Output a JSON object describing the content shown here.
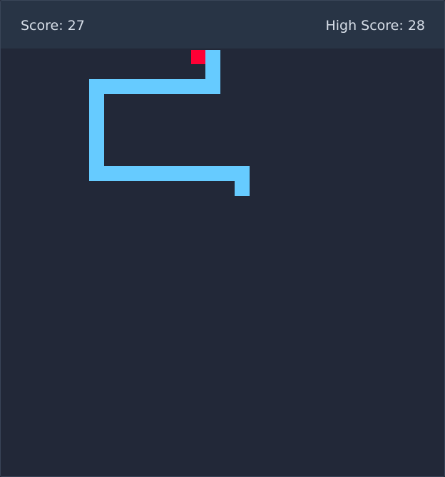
{
  "game": {
    "title": "",
    "score_label": "Score: 27",
    "high_score_label": "High Score: 28",
    "score": 27,
    "high_score": 28
  },
  "board": {
    "columns": 31,
    "rows": 30
  },
  "snake": {
    "color": "#66cbff",
    "segments": [
      {
        "col": 16,
        "row": 10
      },
      {
        "col": 16,
        "row": 9
      },
      {
        "col": 15,
        "row": 9
      },
      {
        "col": 14,
        "row": 9
      },
      {
        "col": 13,
        "row": 9
      },
      {
        "col": 12,
        "row": 9
      },
      {
        "col": 11,
        "row": 9
      },
      {
        "col": 10,
        "row": 9
      },
      {
        "col": 9,
        "row": 9
      },
      {
        "col": 8,
        "row": 9
      },
      {
        "col": 7,
        "row": 9
      },
      {
        "col": 6,
        "row": 9
      },
      {
        "col": 6,
        "row": 8
      },
      {
        "col": 6,
        "row": 7
      },
      {
        "col": 6,
        "row": 6
      },
      {
        "col": 6,
        "row": 5
      },
      {
        "col": 6,
        "row": 4
      },
      {
        "col": 6,
        "row": 3
      },
      {
        "col": 7,
        "row": 3
      },
      {
        "col": 8,
        "row": 3
      },
      {
        "col": 9,
        "row": 3
      },
      {
        "col": 10,
        "row": 3
      },
      {
        "col": 11,
        "row": 3
      },
      {
        "col": 12,
        "row": 3
      },
      {
        "col": 13,
        "row": 3
      },
      {
        "col": 14,
        "row": 3
      },
      {
        "col": 14,
        "row": 2
      },
      {
        "col": 14,
        "row": 1
      }
    ]
  },
  "food": {
    "color": "#ff0035",
    "col": 13,
    "row": 1
  },
  "colors": {
    "background": "#222838",
    "header": "#283445",
    "text": "#d8dfe9"
  }
}
